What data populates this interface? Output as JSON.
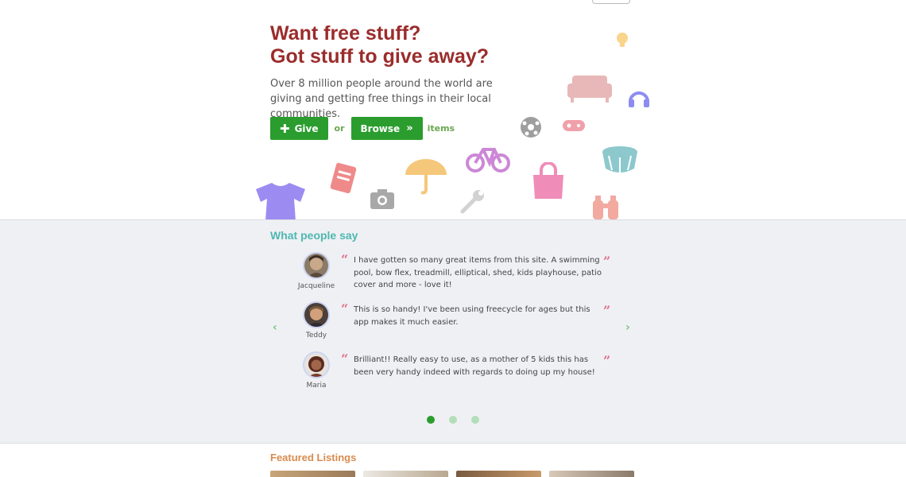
{
  "hero": {
    "headline_line1": "Want free stuff?",
    "headline_line2": "Got stuff to give away?",
    "subtext": "Over 8 million people around the world are giving and getting free things in their local communities.",
    "give_label": "Give",
    "or_label": "or",
    "browse_label": "Browse",
    "items_label": "items",
    "accent_color": "#2a9d2e",
    "headline_color": "#9b2c2c"
  },
  "decor_icons": [
    "lightbulb-icon",
    "sofa-icon",
    "headphones-icon",
    "soccer-ball-icon",
    "gamepad-icon",
    "bicycle-icon",
    "drum-icon",
    "book-icon",
    "umbrella-icon",
    "shopping-bag-icon",
    "tshirt-icon",
    "camera-icon",
    "wrench-icon",
    "binoculars-icon"
  ],
  "testimonials": {
    "title": "What people say",
    "items": [
      {
        "name": "Jacqueline",
        "text": "I have gotten so many great items from this site. A swimming pool, bow flex, treadmill, elliptical, shed, kids playhouse, patio cover and more - love it!"
      },
      {
        "name": "Teddy",
        "text": "This is so handy! I've been using freecycle for ages but this app makes it much easier."
      },
      {
        "name": "Maria",
        "text": "Brilliant!! Really easy to use, as a mother of 5 kids this has been very handy indeed with regards to doing up my house!"
      }
    ],
    "open_quote": "“",
    "close_quote": "”",
    "prev_arrow": "‹",
    "next_arrow": "›",
    "page_count": 3,
    "active_page": 1
  },
  "featured": {
    "title": "Featured Listings"
  }
}
